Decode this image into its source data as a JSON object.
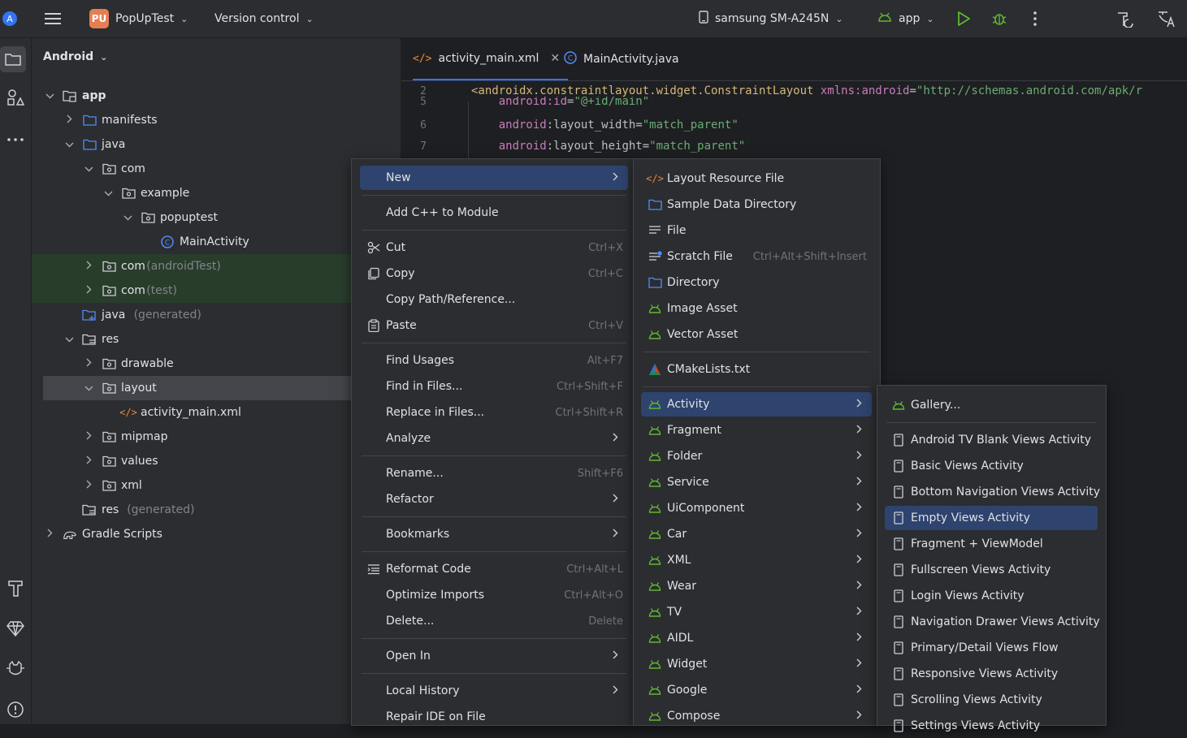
{
  "topbar": {
    "project_badge": "PU",
    "project_name": "PopUpTest",
    "vcs": "Version control",
    "device": "samsung SM-A245N",
    "run_config": "app"
  },
  "project_panel": {
    "view": "Android",
    "tree": [
      {
        "label": "app",
        "suffix": "",
        "icon": "module-folder-icon",
        "chev": "down"
      },
      {
        "label": "manifests",
        "suffix": "",
        "icon": "folder-icon",
        "chev": "right"
      },
      {
        "label": "java",
        "suffix": "",
        "icon": "folder-icon",
        "chev": "down"
      },
      {
        "label": "com",
        "suffix": "",
        "icon": "package-icon",
        "chev": "down"
      },
      {
        "label": "example",
        "suffix": "",
        "icon": "package-icon",
        "chev": "down"
      },
      {
        "label": "popuptest",
        "suffix": "",
        "icon": "package-icon",
        "chev": "down"
      },
      {
        "label": "MainActivity",
        "suffix": "",
        "icon": "class-icon",
        "chev": ""
      },
      {
        "label": "com",
        "suffix": "(androidTest)",
        "icon": "package-icon",
        "chev": "right"
      },
      {
        "label": "com",
        "suffix": "(test)",
        "icon": "package-icon",
        "chev": "right"
      },
      {
        "label": "java",
        "suffix": "(generated)",
        "icon": "generated-folder-icon",
        "chev": ""
      },
      {
        "label": "res",
        "suffix": "",
        "icon": "res-folder-icon",
        "chev": "down"
      },
      {
        "label": "drawable",
        "suffix": "",
        "icon": "package-icon",
        "chev": "right"
      },
      {
        "label": "layout",
        "suffix": "",
        "icon": "package-icon",
        "chev": "down"
      },
      {
        "label": "activity_main.xml",
        "suffix": "",
        "icon": "xml-file-icon",
        "chev": ""
      },
      {
        "label": "mipmap",
        "suffix": "",
        "icon": "package-icon",
        "chev": "right"
      },
      {
        "label": "values",
        "suffix": "",
        "icon": "package-icon",
        "chev": "right"
      },
      {
        "label": "xml",
        "suffix": "",
        "icon": "package-icon",
        "chev": "right"
      },
      {
        "label": "res",
        "suffix": "(generated)",
        "icon": "res-folder-icon",
        "chev": ""
      },
      {
        "label": "Gradle Scripts",
        "suffix": "",
        "icon": "gradle-icon",
        "chev": "right"
      }
    ]
  },
  "editor": {
    "tabs": [
      "activity_main.xml",
      "MainActivity.java"
    ],
    "lines": [
      {
        "n": "2",
        "tag": "<androidx.constraintlayout.widget.ConstraintLayout ",
        "attr": "xmlns:android",
        "eq": "=",
        "str": "\"http://schemas.android.com/apk/r"
      },
      {
        "n": "5",
        "tag": "",
        "attr": "android:id",
        "eq": "=",
        "str": "\"@+id/main\""
      },
      {
        "n": "6",
        "tag": "",
        "attr": "android",
        "eq": ":layout_width=",
        "str": "\"match_parent\""
      },
      {
        "n": "7",
        "tag": "",
        "attr": "android",
        "eq": ":layout_height=",
        "str": "\"match_parent\""
      }
    ]
  },
  "context_menu": {
    "items": [
      {
        "label": "New",
        "shortcut": "",
        "submenu": true,
        "icon": ""
      },
      {
        "label": "Add C++ to Module",
        "shortcut": "",
        "submenu": false,
        "icon": ""
      },
      {
        "label": "Cut",
        "shortcut": "Ctrl+X",
        "submenu": false,
        "icon": "scissors-icon"
      },
      {
        "label": "Copy",
        "shortcut": "Ctrl+C",
        "submenu": false,
        "icon": "copy-icon"
      },
      {
        "label": "Copy Path/Reference...",
        "shortcut": "",
        "submenu": false,
        "icon": ""
      },
      {
        "label": "Paste",
        "shortcut": "Ctrl+V",
        "submenu": false,
        "icon": "clipboard-icon"
      },
      {
        "label": "Find Usages",
        "shortcut": "Alt+F7",
        "submenu": false,
        "icon": ""
      },
      {
        "label": "Find in Files...",
        "shortcut": "Ctrl+Shift+F",
        "submenu": false,
        "icon": ""
      },
      {
        "label": "Replace in Files...",
        "shortcut": "Ctrl+Shift+R",
        "submenu": false,
        "icon": ""
      },
      {
        "label": "Analyze",
        "shortcut": "",
        "submenu": true,
        "icon": ""
      },
      {
        "label": "Rename...",
        "shortcut": "Shift+F6",
        "submenu": false,
        "icon": ""
      },
      {
        "label": "Refactor",
        "shortcut": "",
        "submenu": true,
        "icon": ""
      },
      {
        "label": "Bookmarks",
        "shortcut": "",
        "submenu": true,
        "icon": ""
      },
      {
        "label": "Reformat Code",
        "shortcut": "Ctrl+Alt+L",
        "submenu": false,
        "icon": "reformat-icon"
      },
      {
        "label": "Optimize Imports",
        "shortcut": "Ctrl+Alt+O",
        "submenu": false,
        "icon": ""
      },
      {
        "label": "Delete...",
        "shortcut": "Delete",
        "submenu": false,
        "icon": ""
      },
      {
        "label": "Open In",
        "shortcut": "",
        "submenu": true,
        "icon": ""
      },
      {
        "label": "Local History",
        "shortcut": "",
        "submenu": true,
        "icon": ""
      },
      {
        "label": "Repair IDE on File",
        "shortcut": "",
        "submenu": false,
        "icon": ""
      }
    ]
  },
  "new_menu": {
    "items": [
      {
        "label": "Layout Resource File",
        "shortcut": "",
        "submenu": false,
        "icon": "xml-file-icon"
      },
      {
        "label": "Sample Data Directory",
        "shortcut": "",
        "submenu": false,
        "icon": "folder-icon"
      },
      {
        "label": "File",
        "shortcut": "",
        "submenu": false,
        "icon": "file-icon"
      },
      {
        "label": "Scratch File",
        "shortcut": "Ctrl+Alt+Shift+Insert",
        "submenu": false,
        "icon": "scratch-file-icon"
      },
      {
        "label": "Directory",
        "shortcut": "",
        "submenu": false,
        "icon": "folder-icon"
      },
      {
        "label": "Image Asset",
        "shortcut": "",
        "submenu": false,
        "icon": "android-icon"
      },
      {
        "label": "Vector Asset",
        "shortcut": "",
        "submenu": false,
        "icon": "android-icon"
      },
      {
        "label": "CMakeLists.txt",
        "shortcut": "",
        "submenu": false,
        "icon": "cmake-icon"
      },
      {
        "label": "Activity",
        "shortcut": "",
        "submenu": true,
        "icon": "android-icon"
      },
      {
        "label": "Fragment",
        "shortcut": "",
        "submenu": true,
        "icon": "android-icon"
      },
      {
        "label": "Folder",
        "shortcut": "",
        "submenu": true,
        "icon": "android-icon"
      },
      {
        "label": "Service",
        "shortcut": "",
        "submenu": true,
        "icon": "android-icon"
      },
      {
        "label": "UiComponent",
        "shortcut": "",
        "submenu": true,
        "icon": "android-icon"
      },
      {
        "label": "Car",
        "shortcut": "",
        "submenu": true,
        "icon": "android-icon"
      },
      {
        "label": "XML",
        "shortcut": "",
        "submenu": true,
        "icon": "android-icon"
      },
      {
        "label": "Wear",
        "shortcut": "",
        "submenu": true,
        "icon": "android-icon"
      },
      {
        "label": "TV",
        "shortcut": "",
        "submenu": true,
        "icon": "android-icon"
      },
      {
        "label": "AIDL",
        "shortcut": "",
        "submenu": true,
        "icon": "android-icon"
      },
      {
        "label": "Widget",
        "shortcut": "",
        "submenu": true,
        "icon": "android-icon"
      },
      {
        "label": "Google",
        "shortcut": "",
        "submenu": true,
        "icon": "android-icon"
      },
      {
        "label": "Compose",
        "shortcut": "",
        "submenu": true,
        "icon": "android-icon"
      }
    ]
  },
  "activity_menu": {
    "items": [
      {
        "label": "Gallery...",
        "icon": "android-icon"
      },
      {
        "label": "Android TV Blank Views Activity",
        "icon": "template-icon"
      },
      {
        "label": "Basic Views Activity",
        "icon": "template-icon"
      },
      {
        "label": "Bottom Navigation Views Activity",
        "icon": "template-icon"
      },
      {
        "label": "Empty Views Activity",
        "icon": "template-icon"
      },
      {
        "label": "Fragment + ViewModel",
        "icon": "template-icon"
      },
      {
        "label": "Fullscreen Views Activity",
        "icon": "template-icon"
      },
      {
        "label": "Login Views Activity",
        "icon": "template-icon"
      },
      {
        "label": "Navigation Drawer Views Activity",
        "icon": "template-icon"
      },
      {
        "label": "Primary/Detail Views Flow",
        "icon": "template-icon"
      },
      {
        "label": "Responsive Views Activity",
        "icon": "template-icon"
      },
      {
        "label": "Scrolling Views Activity",
        "icon": "template-icon"
      },
      {
        "label": "Settings Views Activity",
        "icon": "template-icon"
      }
    ]
  },
  "colors": {
    "accent": "#3574f0",
    "menu_highlight": "#2e436e",
    "android_green": "#5fb832",
    "run_green": "#5fb832"
  }
}
